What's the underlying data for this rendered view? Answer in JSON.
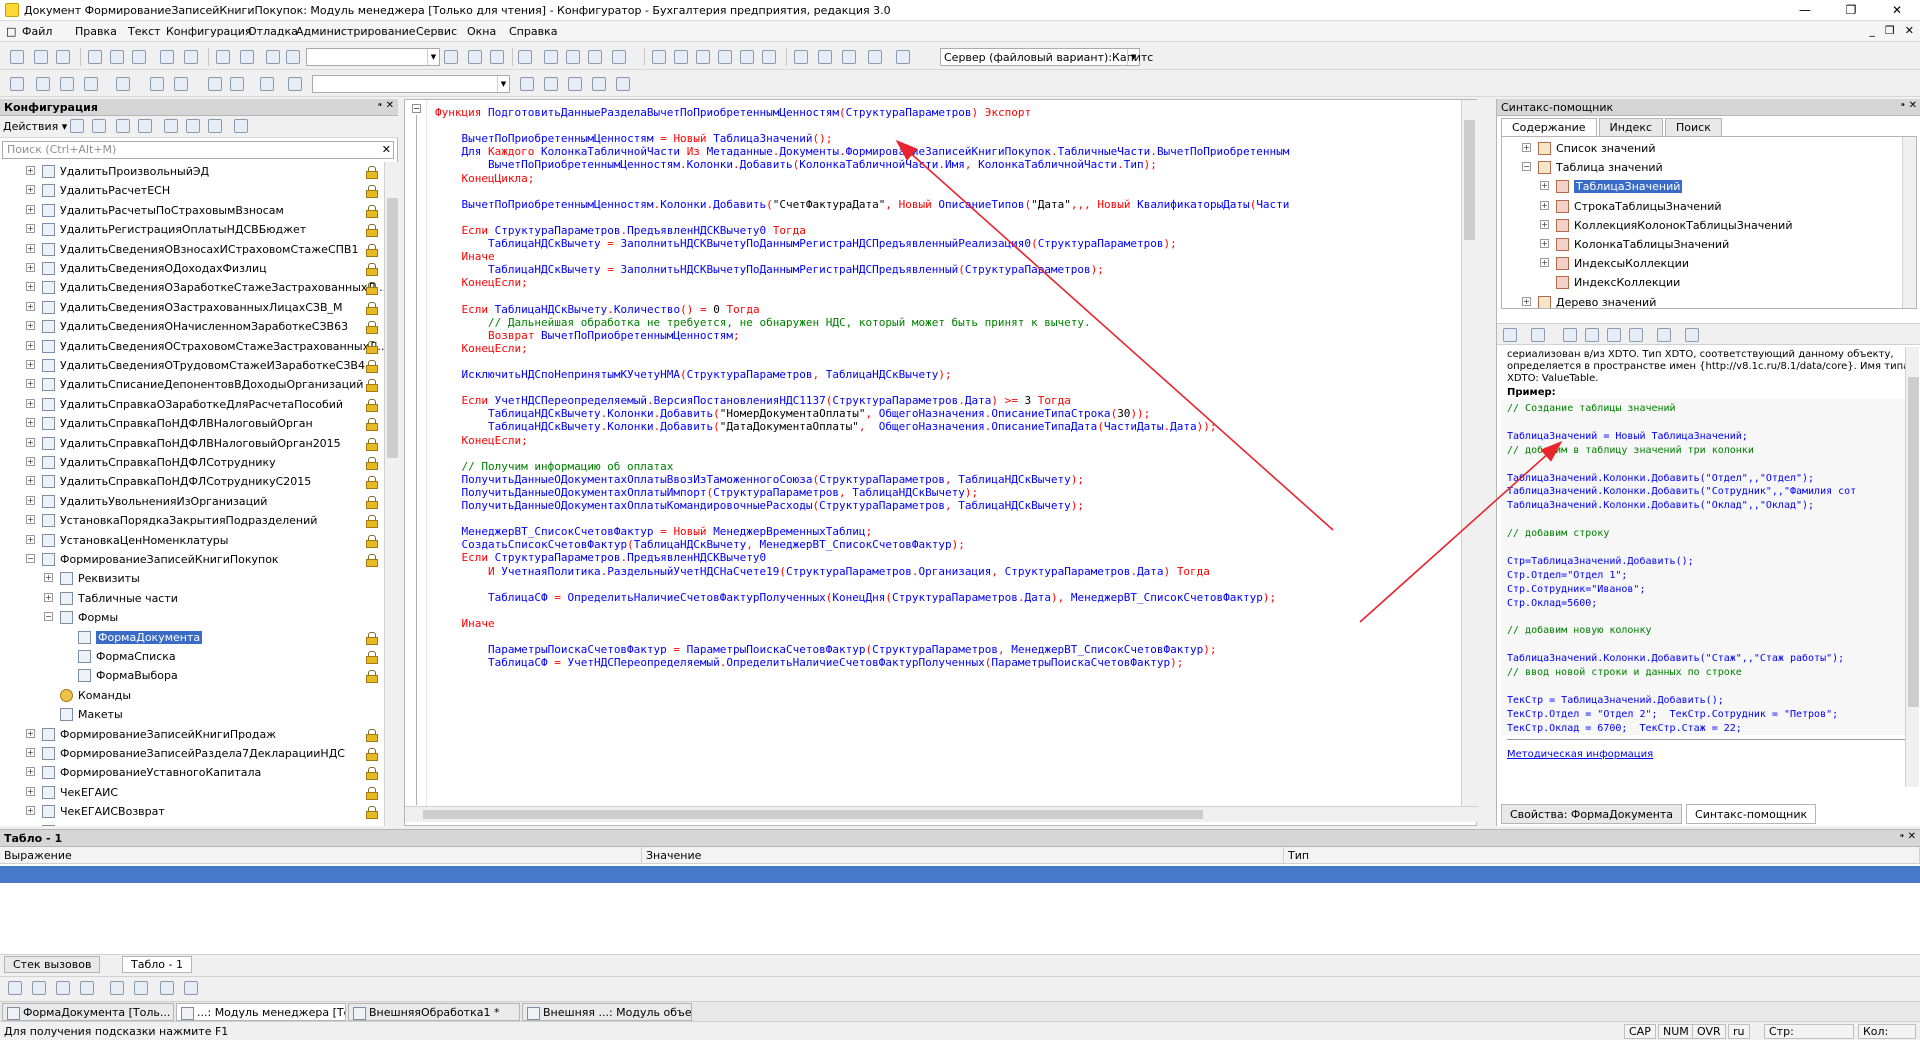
{
  "window": {
    "title": "Документ ФормированиеЗаписейКнигиПокупок: Модуль менеджера [Только для чтения] - Конфигуратор - Бухгалтерия предприятия, редакция 3.0"
  },
  "menu": [
    "Файл",
    "Правка",
    "Текст",
    "Конфигурация",
    "Отладка",
    "Администрирование",
    "Сервис",
    "Окна",
    "Справка"
  ],
  "toolbar": {
    "server_select": "Сервер (файловый вариант):Капитс"
  },
  "config_panel": {
    "title": "Конфигурация",
    "actions_label": "Действия",
    "search_placeholder": "Поиск (Ctrl+Alt+M)",
    "tree": [
      {
        "label": "УдалитьПроизвольныйЭД",
        "lock": true
      },
      {
        "label": "УдалитьРасчетЕСН",
        "lock": true
      },
      {
        "label": "УдалитьРасчетыПоСтраховымВзносам",
        "lock": true
      },
      {
        "label": "УдалитьРегистрацияОплатыНДСВБюджет",
        "lock": true
      },
      {
        "label": "УдалитьСведенияОВзносахИСтраховомСтажеСПВ1",
        "lock": true
      },
      {
        "label": "УдалитьСведенияОДоходахФизлиц",
        "lock": true
      },
      {
        "label": "УдалитьСведенияОЗаработкеСтажеЗастрахованныхЛ...",
        "lock": true
      },
      {
        "label": "УдалитьСведенияОЗастрахованныхЛицахСЗВ_М",
        "lock": true
      },
      {
        "label": "УдалитьСведенияОНачисленномЗаработкеСЗВ63",
        "lock": true
      },
      {
        "label": "УдалитьСведенияОСтраховомСтажеЗастрахованныхЛ...",
        "lock": true
      },
      {
        "label": "УдалитьСведенияОТрудовомСтажеИЗаработкеСЗВ4",
        "lock": true
      },
      {
        "label": "УдалитьСписаниеДепонентовВДоходыОрганизаций",
        "lock": true
      },
      {
        "label": "УдалитьСправкаОЗаработкеДляРасчетаПособий",
        "lock": true
      },
      {
        "label": "УдалитьСправкаПоНДФЛВНалоговыйОрган",
        "lock": true
      },
      {
        "label": "УдалитьСправкаПоНДФЛВНалоговыйОрган2015",
        "lock": true
      },
      {
        "label": "УдалитьСправкаПоНДФЛСотруднику",
        "lock": true
      },
      {
        "label": "УдалитьСправкаПоНДФЛСотрудникуС2015",
        "lock": true
      },
      {
        "label": "УдалитьУвольненияИзОрганизаций",
        "lock": true
      },
      {
        "label": "УстановкаПорядкаЗакрытияПодразделений",
        "lock": true
      },
      {
        "label": "УстановкаЦенНоменклатуры",
        "lock": true
      },
      {
        "label": "ФормированиеЗаписейКнигиПокупок",
        "lock": true
      },
      {
        "label": "Реквизиты",
        "lock": false
      },
      {
        "label": "Табличные части",
        "lock": false
      },
      {
        "label": "Формы",
        "lock": false
      },
      {
        "label": "ФормаДокумента",
        "lock": true
      },
      {
        "label": "ФормаСписка",
        "lock": true
      },
      {
        "label": "ФормаВыбора",
        "lock": true
      },
      {
        "label": "Команды",
        "lock": false
      },
      {
        "label": "Макеты",
        "lock": false
      },
      {
        "label": "ФормированиеЗаписейКнигиПродаж",
        "lock": true
      },
      {
        "label": "ФормированиеЗаписейРаздела7ДекларацииНДС",
        "lock": true
      },
      {
        "label": "ФормированиеУставногоКапитала",
        "lock": true
      },
      {
        "label": "ЧекЕГАИС",
        "lock": true
      },
      {
        "label": "ЧекЕГАИСВозврат",
        "lock": true
      },
      {
        "label": "ЭлектронныйДокументВходящий",
        "lock": true
      }
    ]
  },
  "code": [
    "Функция ПодготовитьДанныеРазделаВычетПоПриобретеннымЦенностям(СтруктураПараметров) Экспорт",
    "",
    "    ВычетПоПриобретеннымЦенностям = Новый ТаблицаЗначений();",
    "    Для Каждого КолонкаТабличнойЧасти Из Метаданные.Документы.ФормированиеЗаписейКнигиПокупок.ТабличныеЧасти.ВычетПоПриобретенным",
    "        ВычетПоПриобретеннымЦенностям.Колонки.Добавить(КолонкаТабличнойЧасти.Имя, КолонкаТабличнойЧасти.Тип);",
    "    КонецЦикла;",
    "",
    "    ВычетПоПриобретеннымЦенностям.Колонки.Добавить(\"СчетФактураДата\", Новый ОписаниеТипов(\"Дата\",,, Новый КвалификаторыДаты(Части",
    "",
    "    Если СтруктураПараметров.ПредъявленНДСКВычету0 Тогда",
    "        ТаблицаНДСкВычету = ЗаполнитьНДСКВычетуПоДаннымРегистраНДСПредъявленныйРеализация0(СтруктураПараметров);",
    "    Иначе",
    "        ТаблицаНДСкВычету = ЗаполнитьНДСКВычетуПоДаннымРегистраНДСПредъявленный(СтруктураПараметров);",
    "    КонецЕсли;",
    "",
    "    Если ТаблицаНДСкВычету.Количество() = 0 Тогда",
    "        // Дальнейшая обработка не требуется, не обнаружен НДС, который может быть принят к вычету.",
    "        Возврат ВычетПоПриобретеннымЦенностям;",
    "    КонецЕсли;",
    "",
    "    ИсключитьНДСпоНепринятымКУчетуНМА(СтруктураПараметров, ТаблицаНДСкВычету);",
    "",
    "    Если УчетНДСПереопределяемый.ВерсияПостановленияНДС1137(СтруктураПараметров.Дата) >= 3 Тогда",
    "        ТаблицаНДСкВычету.Колонки.Добавить(\"НомерДокументаОплаты\", ОбщегоНазначения.ОписаниеТипаСтрока(30));",
    "        ТаблицаНДСкВычету.Колонки.Добавить(\"ДатаДокументаОплаты\",  ОбщегоНазначения.ОписаниеТипаДата(ЧастиДаты.Дата));",
    "    КонецЕсли;",
    "",
    "    // Получим информацию об оплатах",
    "    ПолучитьДанныеОДокументахОплатыВвозИзТаможенногоСоюза(СтруктураПараметров, ТаблицаНДСкВычету);",
    "    ПолучитьДанныеОДокументахОплатыИмпорт(СтруктураПараметров, ТаблицаНДСкВычету);",
    "    ПолучитьДанныеОДокументахОплатыКомандировочныеРасходы(СтруктураПараметров, ТаблицаНДСкВычету);",
    "",
    "    МенеджерВТ_СписокСчетовФактур = Новый МенеджерВременныхТаблиц;",
    "    СоздатьСписокСчетовФактур(ТаблицаНДСкВычету, МенеджерВТ_СписокСчетовФактур);",
    "    Если СтруктураПараметров.ПредъявленНДСКВычету0",
    "        И УчетнаяПолитика.РаздельныйУчетНДСНаСчете19(СтруктураПараметров.Организация, СтруктураПараметров.Дата) Тогда",
    "",
    "        ТаблицаСФ = ОпределитьНаличиеСчетовФактурПолученных(КонецДня(СтруктураПараметров.Дата), МенеджерВТ_СписокСчетовФактур);",
    "",
    "    Иначе",
    "",
    "        ПараметрыПоискаСчетовФактур = ПараметрыПоискаСчетовФактур(СтруктураПараметров, МенеджерВТ_СписокСчетовФактур);",
    "        ТаблицаСФ = УчетНДСПереопределяемый.ОпределитьНаличиеСчетовФактурПолученных(ПараметрыПоискаСчетовФактур);"
  ],
  "syntax_helper": {
    "title": "Синтакс-помощник",
    "tabs": [
      "Содержание",
      "Индекс",
      "Поиск"
    ],
    "tree": [
      {
        "label": "Список значений",
        "level": 1,
        "exp": "+"
      },
      {
        "label": "Таблица значений",
        "level": 1,
        "exp": "−"
      },
      {
        "label": "ТаблицаЗначений",
        "level": 2,
        "exp": "+",
        "sel": true
      },
      {
        "label": "СтрокаТаблицыЗначений",
        "level": 2,
        "exp": "+"
      },
      {
        "label": "КоллекцияКолонокТаблицыЗначений",
        "level": 2,
        "exp": "+"
      },
      {
        "label": "КолонкаТаблицыЗначений",
        "level": 2,
        "exp": "+"
      },
      {
        "label": "ИндексыКоллекции",
        "level": 2,
        "exp": "+"
      },
      {
        "label": "ИндексКоллекции",
        "level": 2,
        "exp": ""
      },
      {
        "label": "Дерево значений",
        "level": 1,
        "exp": "+"
      }
    ],
    "doc_text1": "сериализован в/из XDTO. Тип XDTO, соответствующий данному объекту,",
    "doc_text2": "определяется в пространстве имен {http://v8.1c.ru/8.1/data/core}. Имя типа",
    "doc_text3": "XDTO: ValueTable.",
    "example_label": "Пример:",
    "example": [
      "// Создание таблицы значений",
      "",
      "ТаблицаЗначений = Новый ТаблицаЗначений;",
      "// добавим в таблицу значений три колонки",
      "",
      "ТаблицаЗначений.Колонки.Добавить(\"Отдел\",,\"Отдел\");",
      "ТаблицаЗначений.Колонки.Добавить(\"Сотрудник\",,\"Фамилия сот",
      "ТаблицаЗначений.Колонки.Добавить(\"Оклад\",,\"Оклад\");",
      "",
      "// добавим строку",
      "",
      "Стр=ТаблицаЗначений.Добавить();",
      "Стр.Отдел=\"Отдел 1\";",
      "Стр.Сотрудник=\"Иванов\";",
      "Стр.Оклад=5600;",
      "",
      "// добавим новую колонку",
      "",
      "ТаблицаЗначений.Колонки.Добавить(\"Стаж\",,\"Стаж работы\");",
      "// ввод новой строки и данных по строке",
      "",
      "ТекСтр = ТаблицаЗначений.Добавить();",
      "ТекСтр.Отдел = \"Отдел 2\";  ТекСтр.Сотрудник = \"Петров\";",
      "ТекСтр.Оклад = 6700;  ТекСтр.Стаж = 22;"
    ],
    "method_info": "Методическая информация",
    "bottom_tabs": [
      "Свойства: ФормаДокумента",
      "Синтакс-помощник"
    ]
  },
  "tablo": {
    "title": "Табло - 1",
    "columns": [
      "Выражение",
      "Значение",
      "Тип"
    ],
    "tabs": [
      "Стек вызовов",
      "Табло - 1"
    ]
  },
  "window_tabs": [
    "ФормаДокумента [Толь...",
    "...: Модуль менеджера [Тол...",
    "ВнешняяОбработка1 *",
    "Внешняя ...: Модуль объекта"
  ],
  "status": {
    "hint": "Для получения подсказки нажмите F1",
    "cap": "CAP",
    "num": "NUM",
    "ovr": "OVR",
    "lang": "ru",
    "line_label": "Стр:",
    "col_label": "Кол:"
  }
}
